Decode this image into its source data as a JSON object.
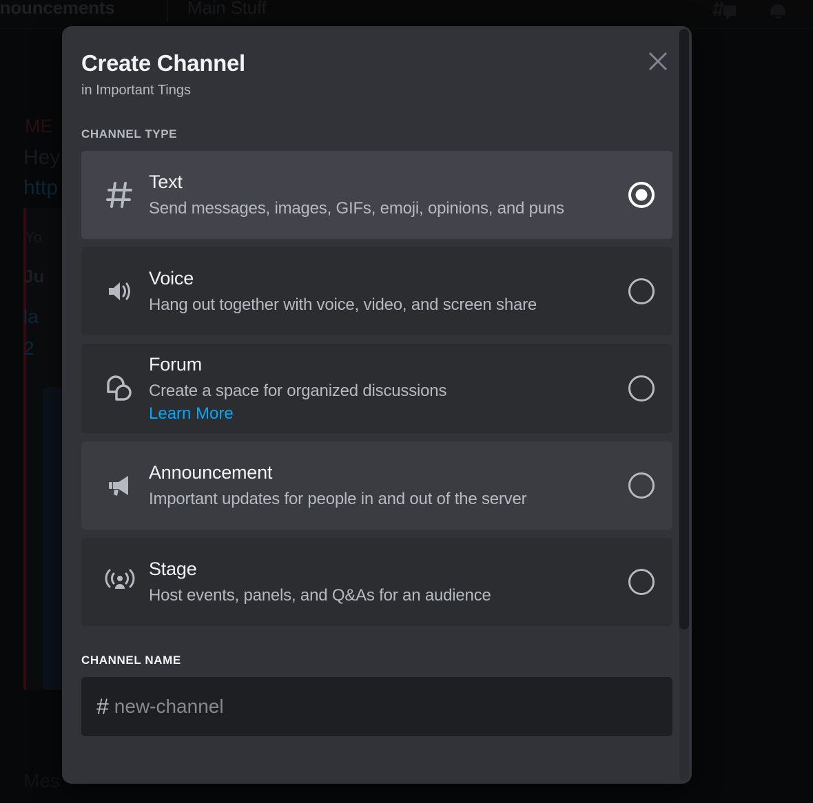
{
  "background": {
    "tab_primary": "nnouncements",
    "tab_secondary": "Main Stuff",
    "threads_icon": "threads-icon",
    "bell_icon": "notification-bell-icon",
    "message_mention": "ME",
    "message_line1": "Hey",
    "message_line2": "http",
    "embed_line1": "Yo",
    "embed_line2": "Ju",
    "embed_line3": "la",
    "embed_line4": "2",
    "composer_placeholder": "Mes"
  },
  "modal": {
    "title": "Create Channel",
    "subtitle": "in Important Tings",
    "close_icon": "close-icon",
    "section_channel_type": "CHANNEL TYPE",
    "section_channel_name": "CHANNEL NAME",
    "channel_types": [
      {
        "id": "text",
        "icon": "hash-icon",
        "title": "Text",
        "description": "Send messages, images, GIFs, emoji, opinions, and puns",
        "selected": true,
        "hovered": false,
        "link": null
      },
      {
        "id": "voice",
        "icon": "speaker-icon",
        "title": "Voice",
        "description": "Hang out together with voice, video, and screen share",
        "selected": false,
        "hovered": false,
        "link": null
      },
      {
        "id": "forum",
        "icon": "forum-bubbles-icon",
        "title": "Forum",
        "description": "Create a space for organized discussions",
        "selected": false,
        "hovered": false,
        "link": "Learn More"
      },
      {
        "id": "announcement",
        "icon": "megaphone-icon",
        "title": "Announcement",
        "description": "Important updates for people in and out of the server",
        "selected": false,
        "hovered": true,
        "link": null
      },
      {
        "id": "stage",
        "icon": "stage-broadcast-icon",
        "title": "Stage",
        "description": "Host events, panels, and Q&As for an audience",
        "selected": false,
        "hovered": false,
        "link": null
      }
    ],
    "channel_name": {
      "prefix": "#",
      "value": "",
      "placeholder": "new-channel"
    }
  },
  "colors": {
    "modal_background": "#313338",
    "row_default": "#2b2d31",
    "row_selected": "#43444b",
    "row_hovered": "#3a3c41",
    "text_primary": "#f2f3f5",
    "text_secondary": "#b5bac1",
    "link_blue": "#00a8fc",
    "input_background": "#1e1f22"
  }
}
